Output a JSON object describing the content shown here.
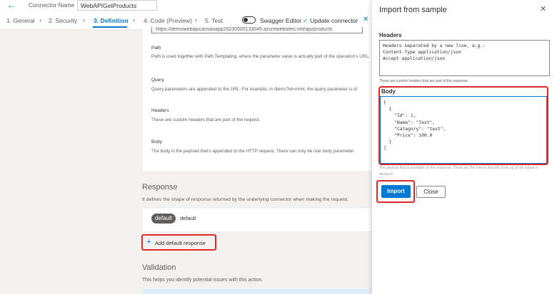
{
  "topbar": {
    "back_icon": "back-arrow-icon",
    "connector_name_label": "Connector Name",
    "connector_name_value": "WebAPIGetProducts"
  },
  "steps": [
    {
      "label": "1. General"
    },
    {
      "label": "2. Security"
    },
    {
      "label": "3. Definition"
    },
    {
      "label": "4. Code (Preview)"
    },
    {
      "label": "5. Test"
    }
  ],
  "toolbar": {
    "swagger_label": "Swagger Editor",
    "update_label": "Update connector"
  },
  "request": {
    "url_value": "https://demowebapicanvasapp20230505133045.azurewebsites.net/api/products",
    "path_title": "Path",
    "path_desc": "Path is used together with Path Templating, where the parameter value is actually part of the operation's URL.",
    "query_title": "Query",
    "query_desc": "Query parameters are appended to the URL. For example, in /items?id=####, the query parameter is id.",
    "headers_title": "Headers",
    "headers_desc": "These are custom headers that are part of the request.",
    "body_title": "Body",
    "body_desc": "The body is the payload that's appended to the HTTP request. There can only be one body parameter."
  },
  "response": {
    "title": "Response",
    "desc": "It defines the shape of response returned by the underlying connector when making the request.",
    "badge": "default",
    "item_label": "default",
    "add_default_label": "Add default response"
  },
  "validation": {
    "title": "Validation",
    "desc": "This helps you identify potential issues with this action."
  },
  "panel": {
    "title": "Import from sample",
    "headers_label": "Headers",
    "headers_placeholder": "Headers separated by a new line, e.g.:\nContent-Type application/json\nAccept application/json",
    "headers_hint": "These are custom headers that are part of the response.",
    "body_label": "Body",
    "body_value": "[\n  {\n    \"Id\": 1,\n    \"Name\": \"Test\",\n    \"Category\": \"test\",\n    \"Price\": 100.0\n  }\n]",
    "body_hint": "The payload that is available on the response. These are the tokens that will show up at the output in designer.",
    "import_label": "Import",
    "close_label": "Close"
  },
  "colors": {
    "accent": "#0078d4",
    "highlight": "#e02828"
  }
}
